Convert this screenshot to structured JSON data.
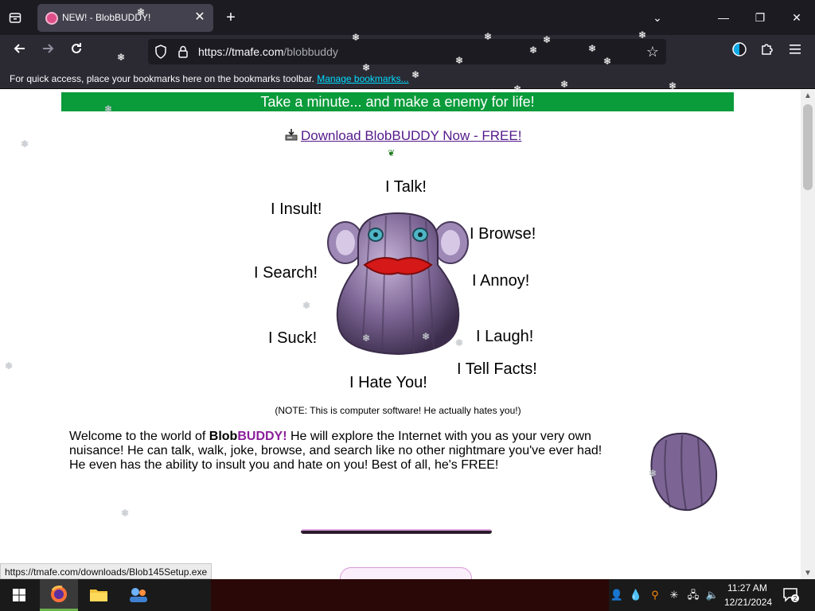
{
  "browser": {
    "tab": {
      "title": "NEW! - BlobBUDDY!",
      "close": "✕"
    },
    "new_tab": "+",
    "window_controls": {
      "list": "⌄",
      "minimize": "—",
      "restore": "❐",
      "close": "✕"
    },
    "url": {
      "host": "https://tmafe.com",
      "path": "/blobbuddy"
    },
    "bookmarks_bar": {
      "text": "For quick access, place your bookmarks here on the bookmarks toolbar.",
      "link": "Manage bookmarks..."
    },
    "status_url": "https://tmafe.com/downloads/Blob145Setup.exe"
  },
  "page": {
    "banner": "Take a minute... and make a enemy for life!",
    "download_link": "Download BlobBUDDY Now - FREE!",
    "features": {
      "talk": "I Talk!",
      "insult": "I Insult!",
      "browse": "I Browse!",
      "search": "I Search!",
      "annoy": "I Annoy!",
      "suck": "I Suck!",
      "laugh": "I Laugh!",
      "facts": "I Tell Facts!",
      "hate": "I Hate You!"
    },
    "note": "(NOTE: This is computer software! He actually hates you!)",
    "welcome": {
      "prefix": "Welcome to the world of ",
      "brand_a": "Blob",
      "brand_b": "BUDDY!",
      "rest": " He will explore the Internet with you as your very own nuisance!  He can talk, walk, joke, browse, and search like no other nightmare you've ever had! He even has the ability to insult you and hate on you! Best of all, he's FREE!"
    }
  },
  "taskbar": {
    "time": "11:27 AM",
    "date": "12/21/2024",
    "notification_count": "2"
  },
  "colors": {
    "banner_bg": "#0a9b3a",
    "link": "#551a8b",
    "brand_purple": "#8b1f9b",
    "chrome_dark": "#1c1b22",
    "chrome_mid": "#2b2a33"
  }
}
